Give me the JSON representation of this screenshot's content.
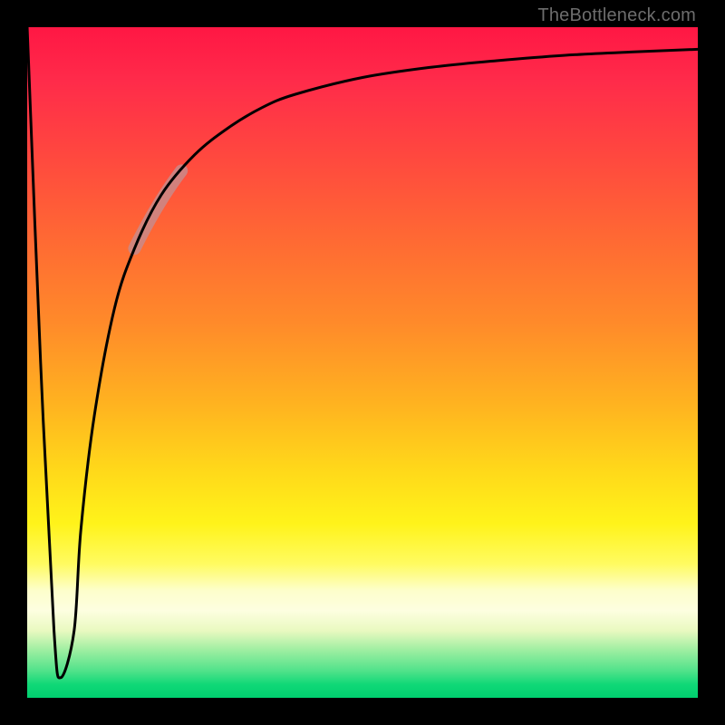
{
  "attribution": "TheBottleneck.com",
  "chart_data": {
    "type": "line",
    "title": "",
    "xlabel": "",
    "ylabel": "",
    "xlim": [
      0,
      100
    ],
    "ylim": [
      0,
      100
    ],
    "grid": false,
    "legend": false,
    "series": [
      {
        "name": "bottleneck-curve",
        "x": [
          0,
          2,
          4,
          5,
          7,
          8,
          10,
          13,
          16,
          20,
          25,
          30,
          35,
          40,
          50,
          60,
          70,
          80,
          90,
          100
        ],
        "y": [
          100,
          50,
          10,
          3,
          10,
          25,
          42,
          58,
          67,
          75,
          81,
          85,
          88,
          90,
          92.5,
          94,
          95,
          95.8,
          96.3,
          96.7
        ]
      }
    ],
    "highlight_segment": {
      "series": "bottleneck-curve",
      "x_start": 16,
      "x_end": 23,
      "note": "short pale/opaque segment overlaid on curve"
    },
    "background_gradient": {
      "top_color": "#ff1744",
      "bottom_color": "#00cf6f",
      "orientation": "vertical"
    }
  }
}
